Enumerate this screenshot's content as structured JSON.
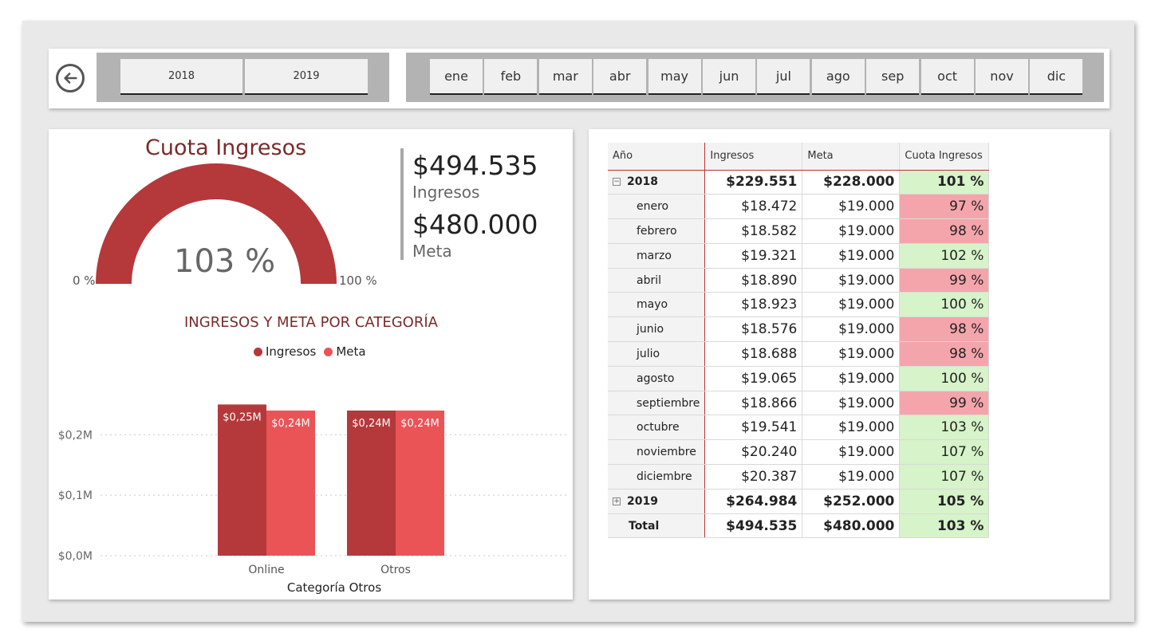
{
  "nav": {
    "back_icon": "back-arrow-icon"
  },
  "year_slicer": {
    "items": [
      "2018",
      "2019"
    ]
  },
  "month_slicer": {
    "items": [
      "ene",
      "feb",
      "mar",
      "abr",
      "may",
      "jun",
      "jul",
      "ago",
      "sep",
      "oct",
      "nov",
      "dic"
    ]
  },
  "gauge": {
    "title": "Cuota Ingresos",
    "value_text": "103 %",
    "min_label": "0 %",
    "max_label": "100 %",
    "value": 103,
    "max": 100,
    "color": "#b5383b"
  },
  "kpi": {
    "ingresos_value": "$494.535",
    "ingresos_label": "Ingresos",
    "meta_value": "$480.000",
    "meta_label": "Meta"
  },
  "colors": {
    "ingresos": "#b5383b",
    "meta": "#ea5457",
    "green": "#d6f3c9",
    "red": "#f4a5ab"
  },
  "chart_data": {
    "type": "bar",
    "title": "INGRESOS Y META POR CATEGORÍA",
    "xlabel": "Categoría Otros",
    "ylabel": "",
    "categories": [
      "Online",
      "Otros"
    ],
    "series": [
      {
        "name": "Ingresos",
        "values": [
          0.25,
          0.24
        ],
        "labels": [
          "$0,25M",
          "$0,24M"
        ]
      },
      {
        "name": "Meta",
        "values": [
          0.24,
          0.24
        ],
        "labels": [
          "$0,24M",
          "$0,24M"
        ]
      }
    ],
    "yticks": [
      0,
      0.1,
      0.2
    ],
    "ytick_labels": [
      "$0,0M",
      "$0,1M",
      "$0,2M"
    ],
    "ylim": [
      0,
      0.265
    ],
    "grid": true,
    "legend": "top"
  },
  "matrix": {
    "headers": [
      "Año",
      "Ingresos",
      "Meta",
      "Cuota Ingresos"
    ],
    "rows": [
      {
        "name": "2018",
        "level": "year",
        "expander": "⊟",
        "ingresos": "$229.551",
        "meta": "$228.000",
        "cuota": "101 %",
        "status": "green"
      },
      {
        "name": "enero",
        "level": "month",
        "ingresos": "$18.472",
        "meta": "$19.000",
        "cuota": "97 %",
        "status": "red"
      },
      {
        "name": "febrero",
        "level": "month",
        "ingresos": "$18.582",
        "meta": "$19.000",
        "cuota": "98 %",
        "status": "red"
      },
      {
        "name": "marzo",
        "level": "month",
        "ingresos": "$19.321",
        "meta": "$19.000",
        "cuota": "102 %",
        "status": "green"
      },
      {
        "name": "abril",
        "level": "month",
        "ingresos": "$18.890",
        "meta": "$19.000",
        "cuota": "99 %",
        "status": "red"
      },
      {
        "name": "mayo",
        "level": "month",
        "ingresos": "$18.923",
        "meta": "$19.000",
        "cuota": "100 %",
        "status": "green"
      },
      {
        "name": "junio",
        "level": "month",
        "ingresos": "$18.576",
        "meta": "$19.000",
        "cuota": "98 %",
        "status": "red"
      },
      {
        "name": "julio",
        "level": "month",
        "ingresos": "$18.688",
        "meta": "$19.000",
        "cuota": "98 %",
        "status": "red"
      },
      {
        "name": "agosto",
        "level": "month",
        "ingresos": "$19.065",
        "meta": "$19.000",
        "cuota": "100 %",
        "status": "green"
      },
      {
        "name": "septiembre",
        "level": "month",
        "ingresos": "$18.866",
        "meta": "$19.000",
        "cuota": "99 %",
        "status": "red"
      },
      {
        "name": "octubre",
        "level": "month",
        "ingresos": "$19.541",
        "meta": "$19.000",
        "cuota": "103 %",
        "status": "green"
      },
      {
        "name": "noviembre",
        "level": "month",
        "ingresos": "$20.240",
        "meta": "$19.000",
        "cuota": "107 %",
        "status": "green"
      },
      {
        "name": "diciembre",
        "level": "month",
        "ingresos": "$20.387",
        "meta": "$19.000",
        "cuota": "107 %",
        "status": "green"
      },
      {
        "name": "2019",
        "level": "year",
        "expander": "⊞",
        "ingresos": "$264.984",
        "meta": "$252.000",
        "cuota": "105 %",
        "status": "green"
      },
      {
        "name": "Total",
        "level": "total",
        "ingresos": "$494.535",
        "meta": "$480.000",
        "cuota": "103 %",
        "status": "green"
      }
    ]
  }
}
